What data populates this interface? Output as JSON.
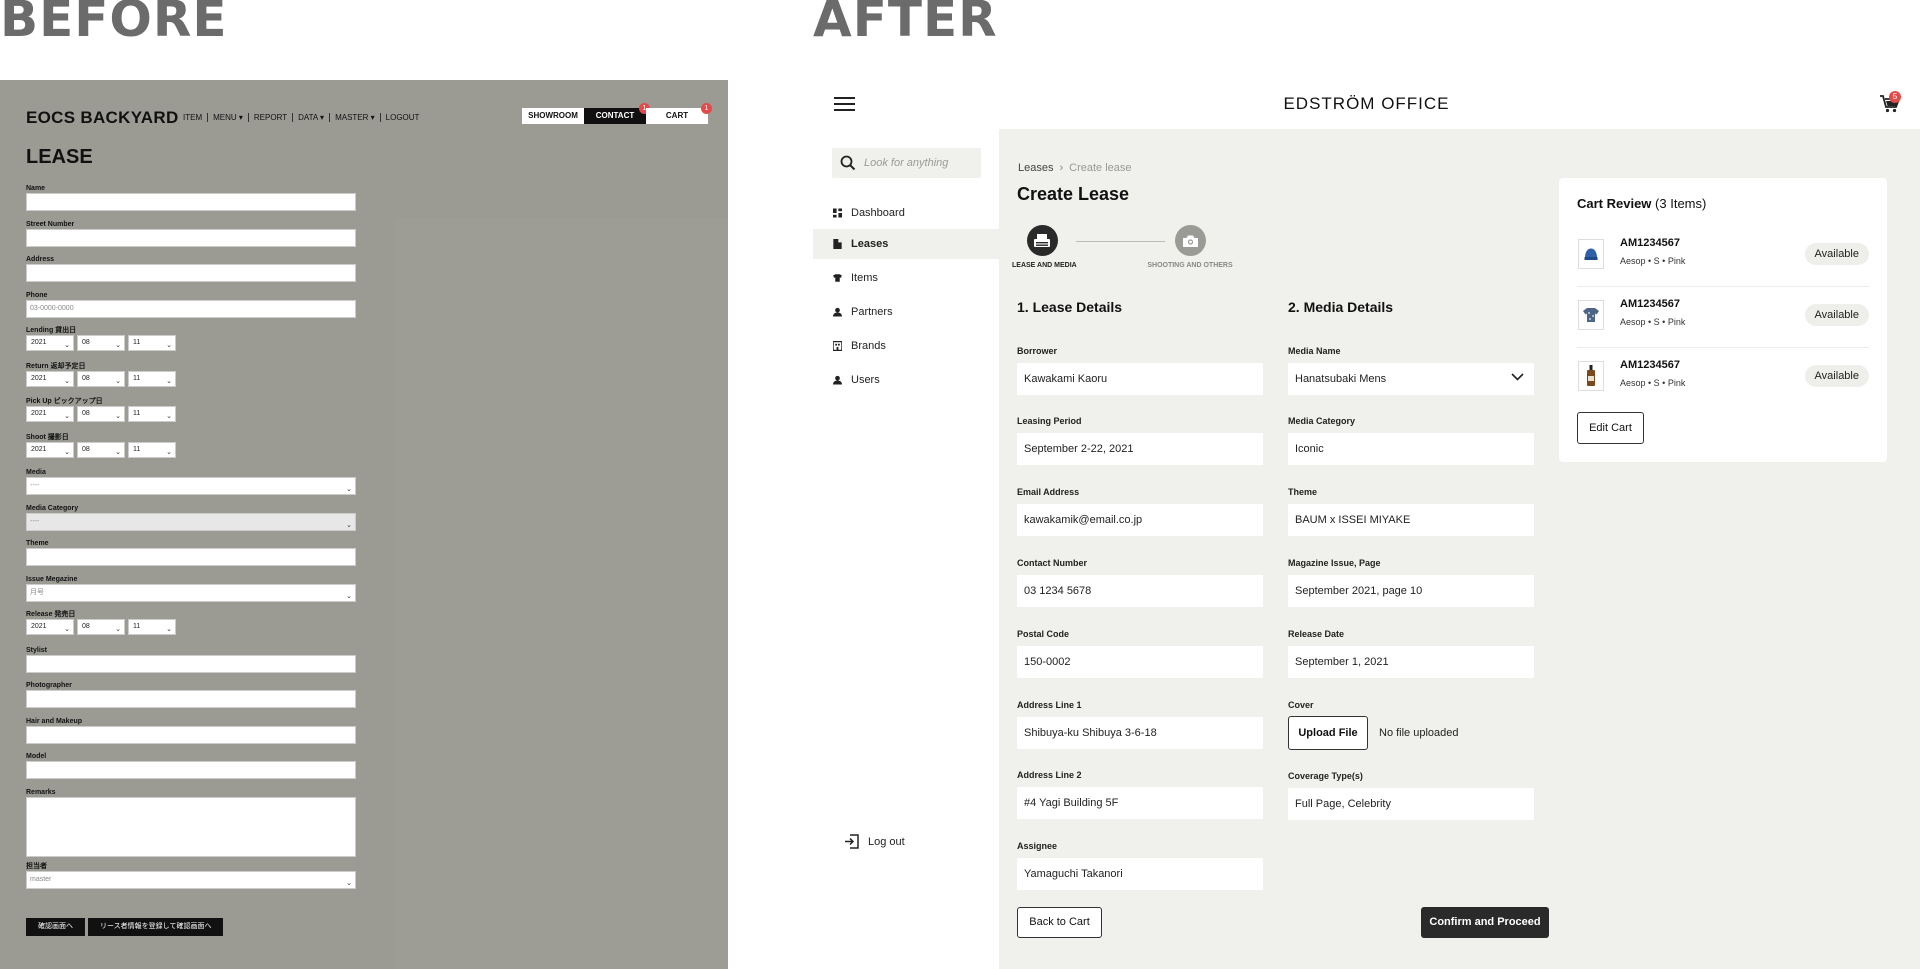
{
  "labels": {
    "before": "BEFORE",
    "after": "AFTER"
  },
  "before": {
    "brand": "EOCS BACKYARD",
    "nav": [
      "ITEM",
      "MENU ▾",
      "REPORT",
      "DATA ▾",
      "MASTER ▾",
      "LOGOUT"
    ],
    "tabs": [
      {
        "label": "SHOWROOM",
        "badge": ""
      },
      {
        "label": "CONTACT",
        "badge": "1"
      },
      {
        "label": "CART",
        "badge": "1"
      }
    ],
    "title": "LEASE",
    "fields": {
      "name": {
        "label": "Name"
      },
      "street": {
        "label": "Street Number"
      },
      "address": {
        "label": "Address"
      },
      "phone": {
        "label": "Phone",
        "placeholder": "03-0000-0000"
      },
      "lending": {
        "label": "Lending 貸出日",
        "year": "2021",
        "month": "08",
        "day": "11"
      },
      "return": {
        "label": "Return 返却予定日",
        "year": "2021",
        "month": "08",
        "day": "11"
      },
      "pickup": {
        "label": "Pick Up ピックアップ日",
        "year": "2021",
        "month": "08",
        "day": "11"
      },
      "shoot": {
        "label": "Shoot 撮影日",
        "year": "2021",
        "month": "08",
        "day": "11"
      },
      "media": {
        "label": "Media",
        "value": "----"
      },
      "media_category": {
        "label": "Media Category",
        "value": "----"
      },
      "theme": {
        "label": "Theme"
      },
      "issue": {
        "label": "Issue Megazine",
        "value": "月号"
      },
      "release": {
        "label": "Release 発売日",
        "year": "2021",
        "month": "08",
        "day": "11"
      },
      "stylist": {
        "label": "Stylist"
      },
      "photographer": {
        "label": "Photographer"
      },
      "hair": {
        "label": "Hair and Makeup"
      },
      "model": {
        "label": "Model"
      },
      "remarks": {
        "label": "Remarks"
      },
      "manager": {
        "label": "担当者",
        "value": "master"
      }
    },
    "buttons": {
      "confirm": "確認画面へ",
      "register": "リース者情報を登録して確認画面へ"
    }
  },
  "after": {
    "brand": "EDSTRÖM OFFICE",
    "cart_badge": "5",
    "search_placeholder": "Look for anything",
    "nav": [
      "Dashboard",
      "Leases",
      "Items",
      "Partners",
      "Brands",
      "Users"
    ],
    "active_nav": "Leases",
    "logout": "Log out",
    "breadcrumb": {
      "parent": "Leases",
      "current": "Create lease"
    },
    "page_title": "Create Lease",
    "steps": [
      {
        "label": "LEASE AND MEDIA",
        "active": true
      },
      {
        "label": "SHOOTING AND OTHERS",
        "active": false
      }
    ],
    "lease": {
      "title": "1. Lease Details",
      "fields": [
        {
          "label": "Borrower",
          "value": "Kawakami Kaoru"
        },
        {
          "label": "Leasing Period",
          "value": "September 2-22, 2021"
        },
        {
          "label": "Email Address",
          "value": "kawakamik@email.co.jp"
        },
        {
          "label": "Contact Number",
          "value": "03 1234 5678"
        },
        {
          "label": "Postal Code",
          "value": "150-0002"
        },
        {
          "label": "Address Line 1",
          "value": "Shibuya-ku Shibuya 3-6-18"
        },
        {
          "label": "Address Line 2",
          "value": "#4 Yagi Building 5F"
        },
        {
          "label": "Assignee",
          "value": "Yamaguchi Takanori"
        }
      ]
    },
    "media": {
      "title": "2. Media Details",
      "media_name": {
        "label": "Media Name",
        "value": "Hanatsubaki Mens"
      },
      "media_category": {
        "label": "Media Category",
        "value": "Iconic"
      },
      "theme": {
        "label": "Theme",
        "value": "BAUM x ISSEI MIYAKE"
      },
      "issue": {
        "label": "Magazine Issue, Page",
        "value": "September 2021, page 10"
      },
      "release": {
        "label": "Release Date",
        "value": "September 1, 2021"
      },
      "cover": {
        "label": "Cover",
        "button": "Upload File",
        "status": "No file uploaded"
      },
      "coverage": {
        "label": "Coverage Type(s)",
        "value": "Full Page, Celebrity"
      }
    },
    "back_button": "Back to Cart",
    "confirm_button": "Confirm and Proceed",
    "cart": {
      "title": "Cart Review",
      "count": "(3 Items)",
      "items": [
        {
          "sku": "AM1234567",
          "meta": "Aesop • S • Pink",
          "status": "Available",
          "icon": "beanie-icon"
        },
        {
          "sku": "AM1234567",
          "meta": "Aesop • S • Pink",
          "status": "Available",
          "icon": "shirt-icon"
        },
        {
          "sku": "AM1234567",
          "meta": "Aesop • S • Pink",
          "status": "Available",
          "icon": "bottle-icon"
        }
      ],
      "edit_button": "Edit Cart"
    },
    "colors": {
      "accent_dark": "#2a2a2a",
      "main_bg": "#f0f0ec",
      "badge_red": "#e34b4b"
    }
  }
}
